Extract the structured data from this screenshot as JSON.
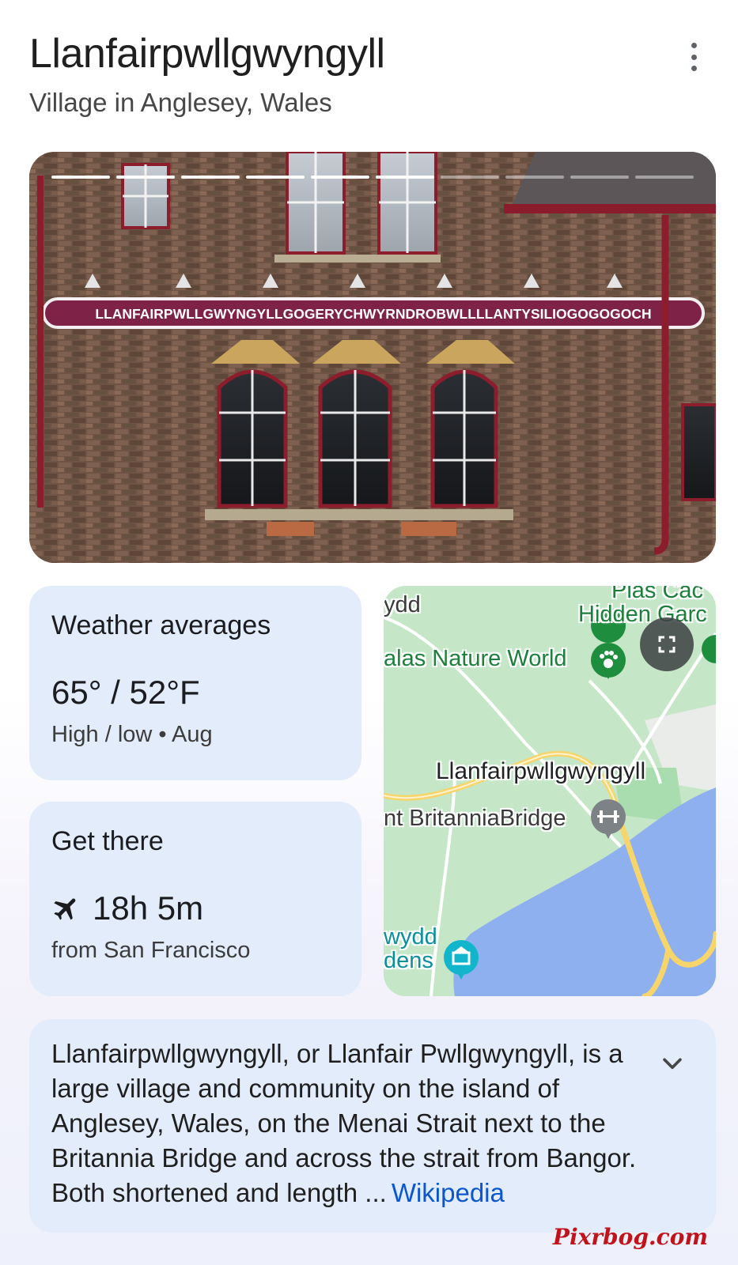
{
  "header": {
    "title": "Llanfairpwllgwyngyll",
    "subtitle": "Village in Anglesey, Wales"
  },
  "hero": {
    "sign_text": "LLANFAIRPWLLGWYNGYLLGOGERYCHWYRNDROBWLLLLANTYSILIOGOGOGOCH",
    "carousel_total": 10,
    "carousel_seen": 6
  },
  "weather": {
    "title": "Weather averages",
    "temps": "65° / 52°F",
    "caption": "High / low • Aug"
  },
  "get_there": {
    "title": "Get there",
    "duration": "18h 5m",
    "origin": "from San Francisco",
    "icon": "airplane-icon"
  },
  "map": {
    "labels": {
      "top_left": "ydd",
      "plas_top": "Plas Cac",
      "plas_bottom": "Hidden Garc",
      "nature_world": "alas Nature World",
      "village": "Llanfairpwllgwyngyll",
      "bridge": "nt BritanniaBridge",
      "bottom_top": "wydd",
      "bottom_bottom": "dens"
    },
    "colors": {
      "land": "#c5e7c8",
      "water": "#8fb0ef",
      "road_major": "#f7d56a",
      "road_minor": "#ffffff",
      "urban": "#e9ece8"
    }
  },
  "description": {
    "text": "Llanfairpwllgwyngyll, or Llanfair Pwllgwyngyll, is a large village and community on the island of Anglesey, Wales, on the Menai Strait next to the Britannia Bridge and across the strait from Bangor. Both shortened and length ...",
    "source": "Wikipedia"
  },
  "watermark": "Pixrbog.com"
}
